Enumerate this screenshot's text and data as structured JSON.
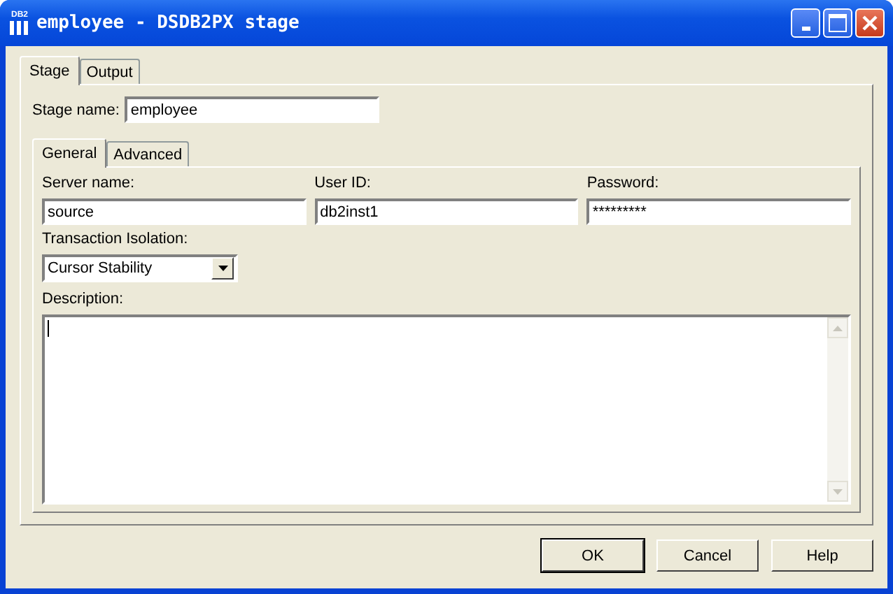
{
  "window": {
    "title": "employee - DSDB2PX stage",
    "icon_text": "DB2"
  },
  "tabs": [
    {
      "label": "Stage",
      "selected": true
    },
    {
      "label": "Output",
      "selected": false
    }
  ],
  "stage_name": {
    "label": "Stage name:",
    "value": "employee"
  },
  "inner_tabs": [
    {
      "label": "General",
      "selected": true
    },
    {
      "label": "Advanced",
      "selected": false
    }
  ],
  "fields": [
    {
      "label": "Server name:",
      "value": "source"
    },
    {
      "label": "User ID:",
      "value": "db2inst1"
    },
    {
      "label": "Password:",
      "value": "*********"
    }
  ],
  "transaction_isolation": {
    "label": "Transaction Isolation:",
    "value": "Cursor Stability"
  },
  "description": {
    "label": "Description:"
  },
  "buttons": [
    {
      "label": "OK",
      "default": true
    },
    {
      "label": "Cancel",
      "default": false
    },
    {
      "label": "Help",
      "default": false
    }
  ]
}
